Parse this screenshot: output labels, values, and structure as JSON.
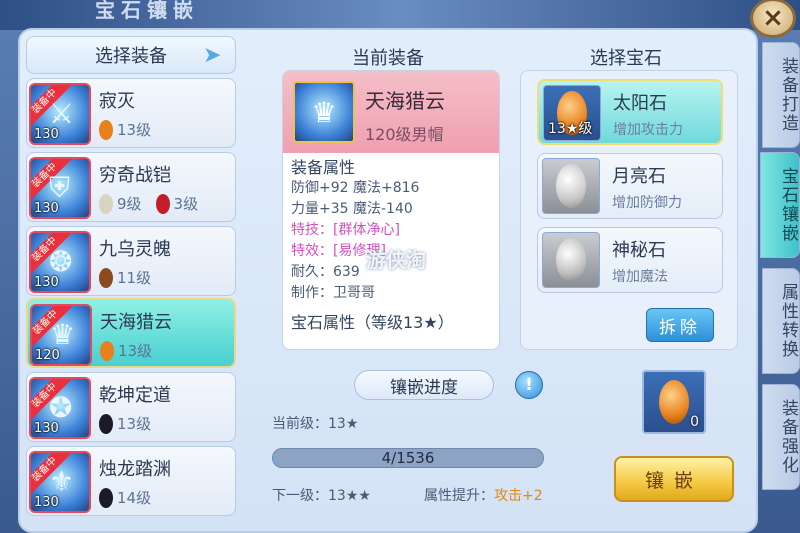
{
  "window": {
    "title": "宝石镶嵌",
    "close_label": "×"
  },
  "side_tabs": [
    "装备打造",
    "宝石镶嵌",
    "属性转换",
    "装备强化"
  ],
  "columns": {
    "left": "选择装备",
    "center": "当前装备",
    "right": "选择宝石"
  },
  "equipment_list": [
    {
      "name": "寂灭",
      "level": "130",
      "badge": "装备中",
      "gems": [
        {
          "count": "13级",
          "color": "#e8801c"
        }
      ]
    },
    {
      "name": "穷奇战铠",
      "level": "130",
      "badge": "装备中",
      "gems": [
        {
          "count": "9级",
          "color": "#d8d4c0"
        },
        {
          "count": "3级",
          "color": "#c41e2a"
        }
      ]
    },
    {
      "name": "九乌灵魄",
      "level": "130",
      "badge": "装备中",
      "gems": [
        {
          "count": "11级",
          "color": "#8a4a1e"
        }
      ]
    },
    {
      "name": "天海猎云",
      "level": "120",
      "badge": "装备中",
      "gems": [
        {
          "count": "13级",
          "color": "#e8801c"
        }
      ]
    },
    {
      "name": "乾坤定道",
      "level": "130",
      "badge": "装备中",
      "gems": [
        {
          "count": "13级",
          "color": "#1a1a2a"
        }
      ]
    },
    {
      "name": "烛龙踏渊",
      "level": "130",
      "badge": "装备中",
      "gems": [
        {
          "count": "14级",
          "color": "#1a1a2a"
        }
      ]
    }
  ],
  "current_equipment": {
    "name": "天海猎云",
    "subtitle": "120级男帽",
    "attr_heading": "装备属性",
    "lines": [
      "防御+92 魔法+816",
      "力量+35 魔法-140"
    ],
    "special_skill": "特技：[群体净心]",
    "special_effect": "特效：[易修理]",
    "durability": "耐久：639",
    "maker": "制作：卫哥哥",
    "gem_attr_heading": "宝石属性（等级13★）"
  },
  "gems": [
    {
      "name": "太阳石",
      "desc": "增加攻击力",
      "count": "13★级",
      "color": "#e8801c",
      "selected": true
    },
    {
      "name": "月亮石",
      "desc": "增加防御力",
      "count": "",
      "color": "#e8e8e8",
      "selected": false
    },
    {
      "name": "神秘石",
      "desc": "增加魔法",
      "count": "",
      "color": "#d8d8d8",
      "selected": false
    }
  ],
  "remove_button": "拆除",
  "progress": {
    "title": "镶嵌进度",
    "info_icon": "!",
    "current_level_label": "当前级：13★",
    "bar_text": "4/1536",
    "fraction": 0.0026,
    "next_level_label": "下一级：13★★",
    "attr_gain_label": "属性提升：",
    "attr_gain_value": "攻击+2"
  },
  "result_slot": {
    "count": "0",
    "color": "#e8801c"
  },
  "inlay_button": "镶嵌",
  "watermark": {
    "main": "游侠淘",
    "sub": "taotaoyouxi.com"
  }
}
